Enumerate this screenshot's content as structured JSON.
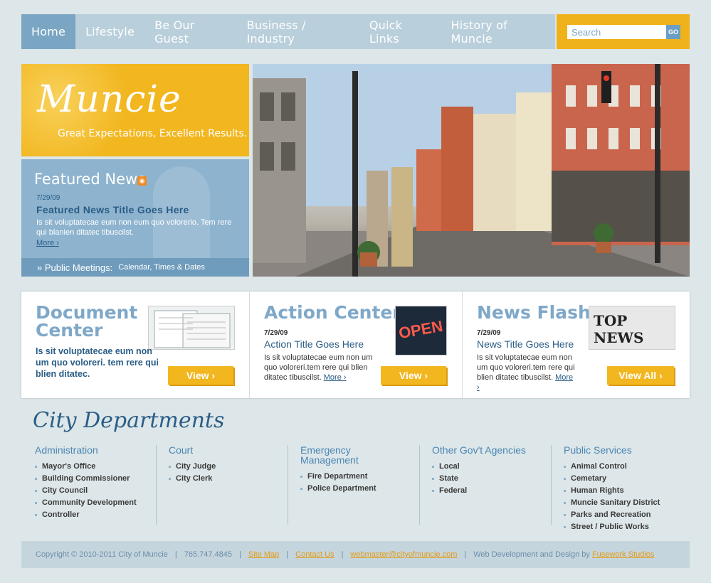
{
  "nav": {
    "items": [
      "Home",
      "Lifestyle",
      "Be Our Guest",
      "Business / Industry",
      "Quick Links",
      "History of Muncie"
    ],
    "active": "Home"
  },
  "search": {
    "placeholder": "Search",
    "go_label": "GO"
  },
  "brand": {
    "title": "Muncie",
    "tagline": "Great Expectations, Excellent Results."
  },
  "featured": {
    "heading": "Featured News",
    "date": "7/29/09",
    "headline": "Featured News Title Goes Here",
    "body": "Is sit voluptatecae eum non eum quo volorerio. Tem rere qui blanien ditatec tibuscilst.",
    "more": "More",
    "meetings_label": "» Public Meetings:",
    "meetings_sub": "Calendar, Times & Dates"
  },
  "panels": {
    "document": {
      "title": "Document Center",
      "body": "Is sit voluptatecae eum non um quo voloreri. tem rere qui blien ditatec.",
      "button": "View ›"
    },
    "action": {
      "title": "Action Center",
      "date": "7/29/09",
      "headline": "Action Title Goes Here",
      "body": "Is sit voluptatecae eum non um quo voloreri.tem rere qui blien ditatec tibuscilst.",
      "more": "More",
      "button": "View ›",
      "thumb_text": "OPEN"
    },
    "news": {
      "title": "News Flash",
      "date": "7/29/09",
      "headline": "News Title Goes Here",
      "body": "Is sit voluptatecae eum non um quo voloreri.tem rere qui blien ditatec tibuscilst.",
      "more": "More",
      "button": "View All ›",
      "thumb_text": "TOP NEWS"
    }
  },
  "departments": {
    "title": "City Departments",
    "columns": [
      {
        "heading": "Administration",
        "items": [
          "Mayor's Office",
          "Building Commissioner",
          "City Council",
          "Community Development",
          "Controller"
        ]
      },
      {
        "heading": "Court",
        "items": [
          "City Judge",
          "City Clerk"
        ]
      },
      {
        "heading": "Emergency Management",
        "items": [
          "Fire Department",
          "Police Department"
        ]
      },
      {
        "heading": "Other Gov't Agencies",
        "items": [
          "Local",
          "State",
          "Federal"
        ]
      },
      {
        "heading": "Public Services",
        "items": [
          "Animal Control",
          "Cemetary",
          "Human Rights",
          "Muncie Sanitary District",
          "Parks and Recreation",
          "Street / Public Works"
        ]
      }
    ]
  },
  "footer": {
    "copyright": "Copyright © 2010-2011 City of Muncie",
    "phone": "765.747.4845",
    "sitemap": "Site Map",
    "contact": "Contact Us",
    "email": "webmaster@cityofmuncie.com",
    "credit": "Web Development and Design by",
    "studio": "Fusework Studios"
  },
  "colors": {
    "accent": "#f2b61f",
    "nav_bg": "#b9cfdb",
    "nav_active": "#7aa6c4",
    "link": "#2a5d86"
  }
}
